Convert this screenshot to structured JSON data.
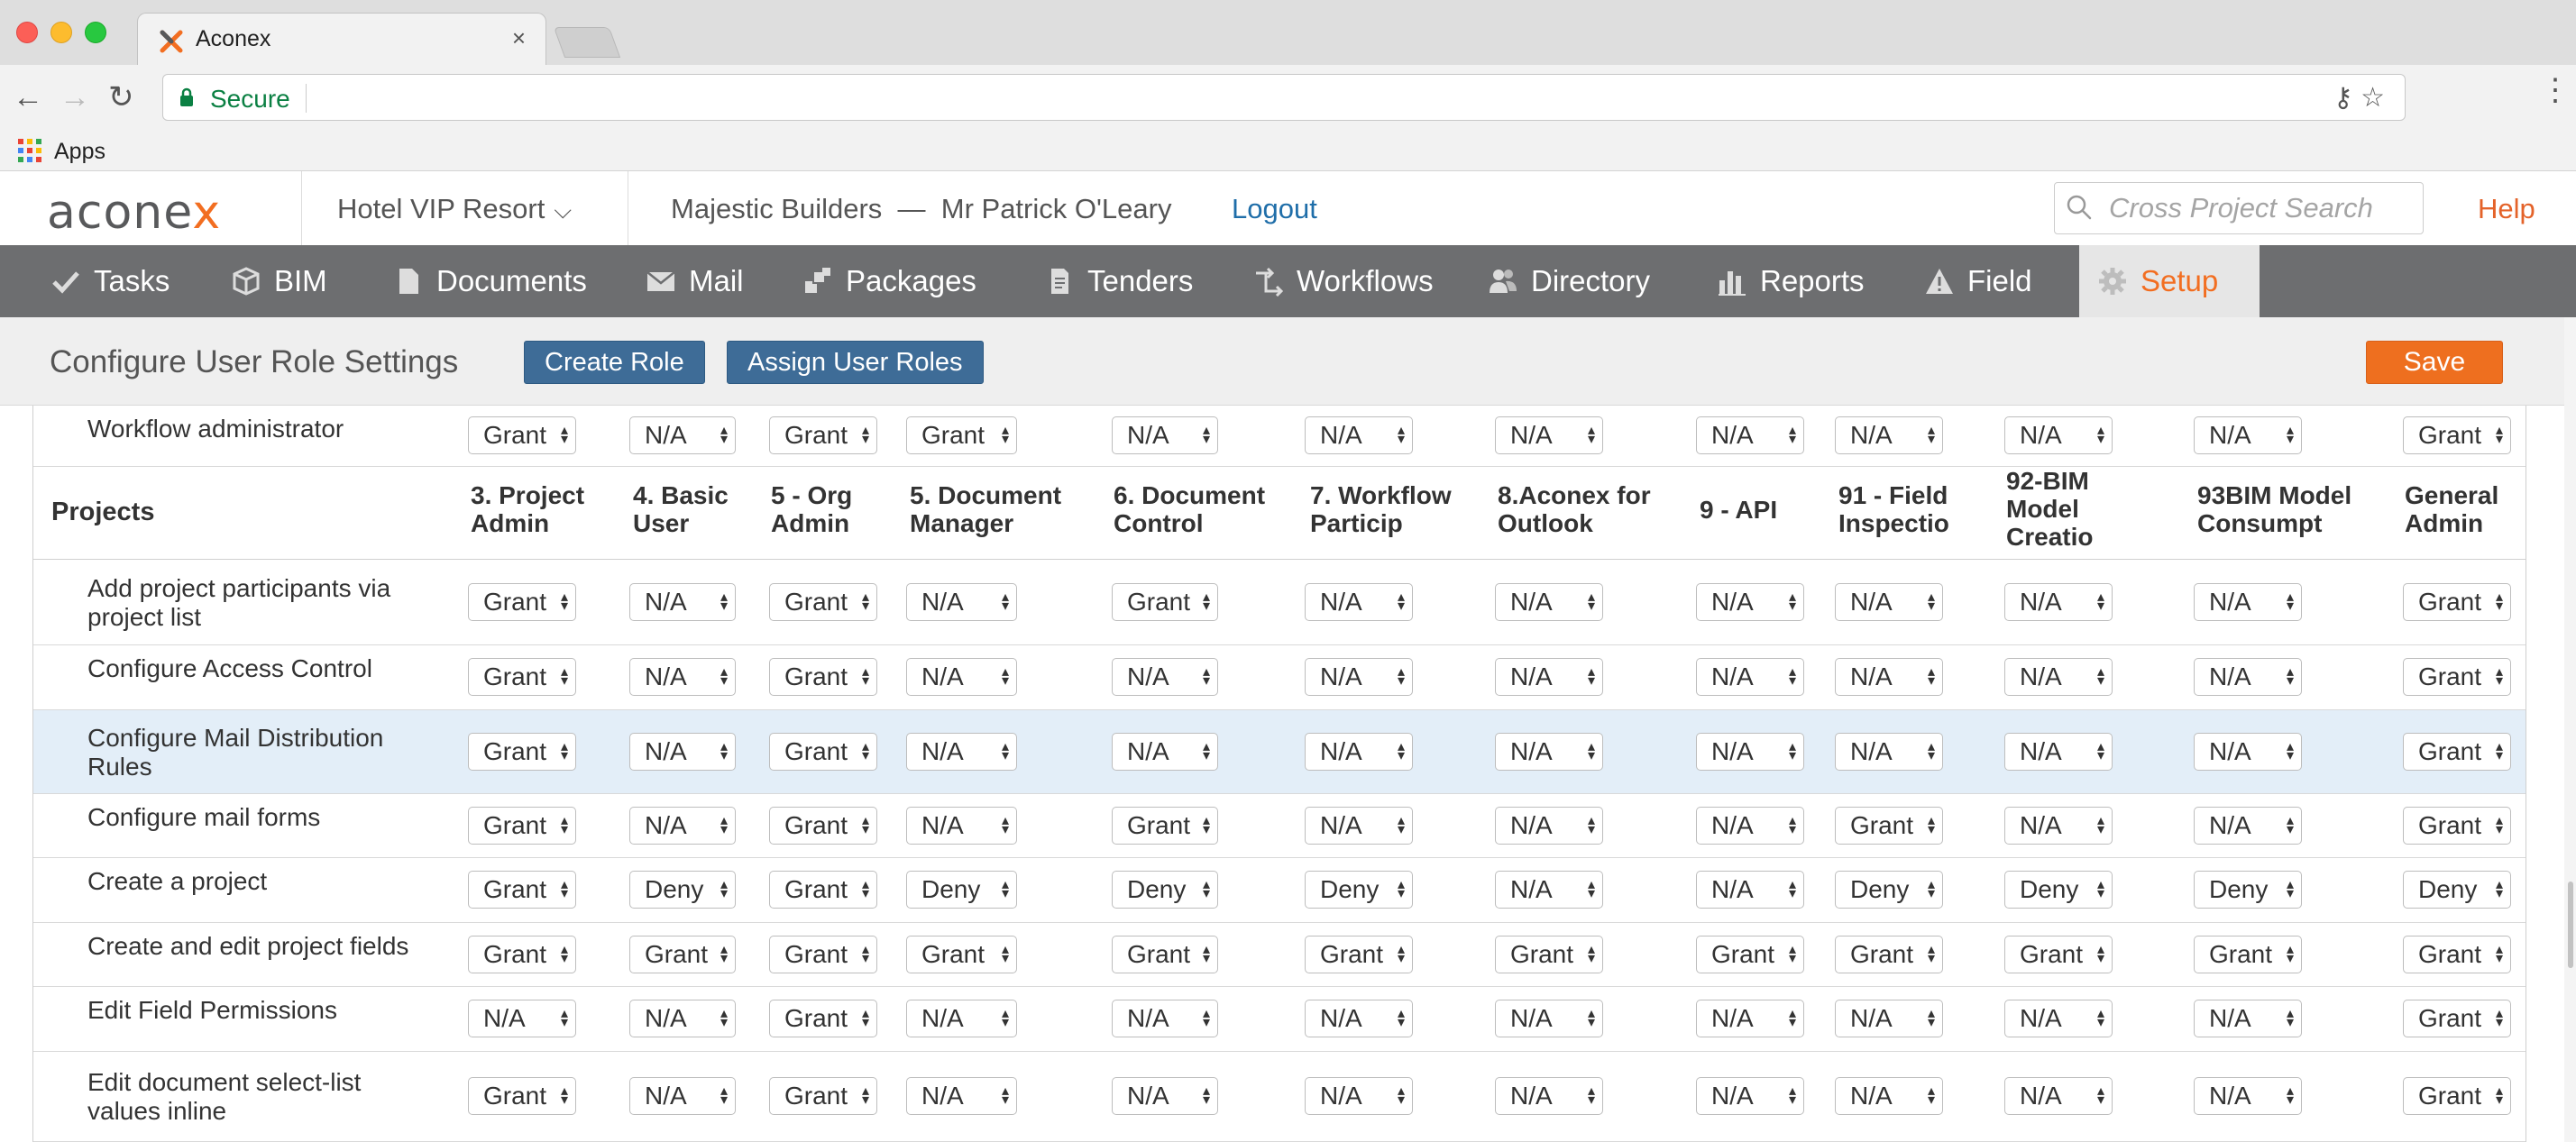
{
  "browser": {
    "tab_title": "Aconex",
    "tab_close": "×",
    "secure_label": "Secure",
    "bookmarks_apps": "Apps"
  },
  "header": {
    "logo_main": "aconex",
    "project": "Hotel VIP Resort",
    "company_user": "Majestic Builders  —  Mr Patrick O'Leary",
    "logout": "Logout",
    "search_placeholder": "Cross Project Search",
    "help": "Help"
  },
  "nav": {
    "items": [
      {
        "label": "Tasks",
        "icon": "check-icon"
      },
      {
        "label": "BIM",
        "icon": "cube-icon"
      },
      {
        "label": "Documents",
        "icon": "document-icon"
      },
      {
        "label": "Mail",
        "icon": "envelope-icon"
      },
      {
        "label": "Packages",
        "icon": "packages-icon"
      },
      {
        "label": "Tenders",
        "icon": "tender-icon"
      },
      {
        "label": "Workflows",
        "icon": "workflow-icon"
      },
      {
        "label": "Directory",
        "icon": "people-icon"
      },
      {
        "label": "Reports",
        "icon": "bar-chart-icon"
      },
      {
        "label": "Field",
        "icon": "warning-icon"
      },
      {
        "label": "Setup",
        "icon": "gear-icon",
        "active": true
      }
    ]
  },
  "page": {
    "title": "Configure User Role Settings",
    "create_role": "Create Role",
    "assign_user_roles": "Assign User Roles",
    "save": "Save"
  },
  "grid": {
    "columns": [
      "3. Project\nAdmin",
      "4. Basic\nUser",
      "5 - Org\nAdmin",
      "5. Document\nManager",
      "6. Document\nControl",
      "7. Workflow\nParticip",
      "8.Aconex for\nOutlook",
      "9 - API",
      "91 - Field\nInspectio",
      "92-BIM\nModel\nCreatio",
      "93BIM Model\nConsumpt",
      "General\nAdmin"
    ],
    "top_row": {
      "label": "Workflow administrator",
      "values": [
        "Grant",
        "N/A",
        "Grant",
        "Grant",
        "N/A",
        "N/A",
        "N/A",
        "N/A",
        "N/A",
        "N/A",
        "N/A",
        "Grant"
      ]
    },
    "section_label": "Projects",
    "rows": [
      {
        "label": "Add project participants via\nproject list",
        "values": [
          "Grant",
          "N/A",
          "Grant",
          "N/A",
          "Grant",
          "N/A",
          "N/A",
          "N/A",
          "N/A",
          "N/A",
          "N/A",
          "Grant"
        ]
      },
      {
        "label": "Configure Access Control",
        "values": [
          "Grant",
          "N/A",
          "Grant",
          "N/A",
          "N/A",
          "N/A",
          "N/A",
          "N/A",
          "N/A",
          "N/A",
          "N/A",
          "Grant"
        ]
      },
      {
        "label": "Configure Mail Distribution\nRules",
        "highlighted": true,
        "values": [
          "Grant",
          "N/A",
          "Grant",
          "N/A",
          "N/A",
          "N/A",
          "N/A",
          "N/A",
          "N/A",
          "N/A",
          "N/A",
          "Grant"
        ]
      },
      {
        "label": "Configure mail forms",
        "values": [
          "Grant",
          "N/A",
          "Grant",
          "N/A",
          "Grant",
          "N/A",
          "N/A",
          "N/A",
          "Grant",
          "N/A",
          "N/A",
          "Grant"
        ]
      },
      {
        "label": "Create a project",
        "values": [
          "Grant",
          "Deny",
          "Grant",
          "Deny",
          "Deny",
          "Deny",
          "N/A",
          "N/A",
          "Deny",
          "Deny",
          "Deny",
          "Deny"
        ]
      },
      {
        "label": "Create and edit project fields",
        "values": [
          "Grant",
          "Grant",
          "Grant",
          "Grant",
          "Grant",
          "Grant",
          "Grant",
          "Grant",
          "Grant",
          "Grant",
          "Grant",
          "Grant"
        ]
      },
      {
        "label": "Edit Field Permissions",
        "values": [
          "N/A",
          "N/A",
          "Grant",
          "N/A",
          "N/A",
          "N/A",
          "N/A",
          "N/A",
          "N/A",
          "N/A",
          "N/A",
          "Grant"
        ]
      },
      {
        "label": "Edit document select-list\nvalues inline",
        "values": [
          "Grant",
          "N/A",
          "Grant",
          "N/A",
          "N/A",
          "N/A",
          "N/A",
          "N/A",
          "N/A",
          "N/A",
          "N/A",
          "Grant"
        ]
      }
    ]
  },
  "colors": {
    "nav_bg": "#6d6e70",
    "accent_orange": "#f26e21",
    "button_blue": "#3e6c97",
    "highlight_row": "#e3eef8",
    "secure_green": "#0b8043"
  }
}
